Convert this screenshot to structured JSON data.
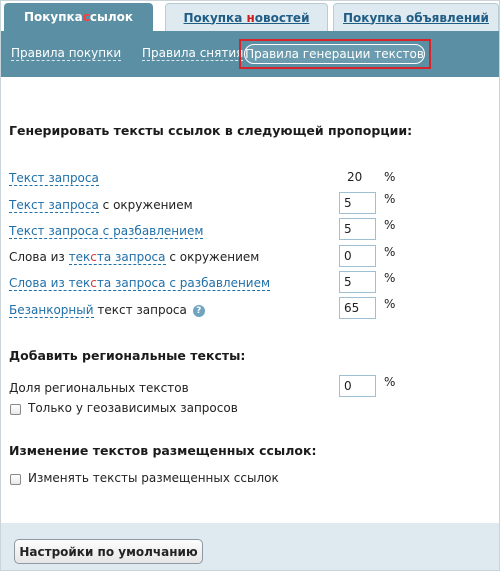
{
  "tabs": [
    {
      "pre": "Покупка ",
      "hl": "с",
      "post": "сылок",
      "active": true
    },
    {
      "pre": "Покупка ",
      "hl": "н",
      "post": "овостей",
      "active": false
    },
    {
      "pre": "Покупка ",
      "hl": "о",
      "post": "бъявлений",
      "active": false
    }
  ],
  "subnav": {
    "purchase_rules": "Правила покупки",
    "removal_rules": "Правила снятия",
    "generation_rules": "Правила генерации текстов"
  },
  "proportions": {
    "title": "Генерировать тексты ссылок в следующей пропорции:",
    "rows": [
      {
        "link": "Текст запроса",
        "suffix": "",
        "value": "20",
        "editable": false
      },
      {
        "link": "Текст запроса",
        "suffix": " с окружением",
        "value": "5",
        "editable": true
      },
      {
        "link": "Текст запроса с разбавлением",
        "suffix": "",
        "value": "5",
        "editable": true
      },
      {
        "prefix": "Слова из ",
        "link_pre": "тек",
        "link_hl": "с",
        "link_post": "та запроса",
        "suffix": " с окружением",
        "value": "0",
        "editable": true
      },
      {
        "link_pre": "Слова из тек",
        "link_hl": "с",
        "link_post": "та запроса с разбавлением",
        "value": "5",
        "editable": true
      },
      {
        "link": "Безанкорный",
        "suffix": " текст запроса",
        "value": "65",
        "editable": true,
        "help": "?"
      }
    ],
    "unit": "%"
  },
  "regional": {
    "title": "Добавить региональные тексты:",
    "share_label": "Доля региональных текстов",
    "share_value": "0",
    "unit": "%",
    "geo_only_label": "Только у геозависимых запросов"
  },
  "change_texts": {
    "title": "Изменение текстов размещенных ссылок:",
    "checkbox_label": "Изменять тексты размещенных ссылок"
  },
  "footer": {
    "default_button": "Настройки по умолчанию"
  }
}
